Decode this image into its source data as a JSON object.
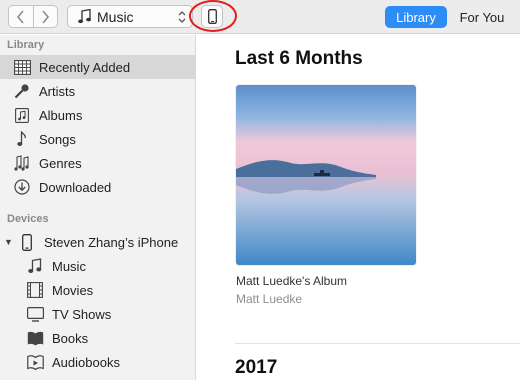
{
  "toolbar": {
    "media_kind": "Music",
    "tabs": [
      {
        "label": "Library",
        "active": true
      },
      {
        "label": "For You",
        "active": false
      }
    ],
    "accent_color": "#2d8cf5",
    "highlight_color": "#e02020"
  },
  "sidebar": {
    "library_title": "Library",
    "library_items": [
      {
        "label": "Recently Added",
        "icon": "grid-icon",
        "selected": true
      },
      {
        "label": "Artists",
        "icon": "microphone-icon"
      },
      {
        "label": "Albums",
        "icon": "album-icon"
      },
      {
        "label": "Songs",
        "icon": "music-note-icon"
      },
      {
        "label": "Genres",
        "icon": "genres-icon"
      },
      {
        "label": "Downloaded",
        "icon": "download-icon"
      }
    ],
    "devices_title": "Devices",
    "device": {
      "label": "Steven Zhang’s iPhone",
      "icon": "iphone-icon"
    },
    "device_items": [
      {
        "label": "Music",
        "icon": "music-note-icon"
      },
      {
        "label": "Movies",
        "icon": "film-icon"
      },
      {
        "label": "TV Shows",
        "icon": "tv-icon"
      },
      {
        "label": "Books",
        "icon": "book-icon"
      },
      {
        "label": "Audiobooks",
        "icon": "audiobook-icon"
      }
    ]
  },
  "main": {
    "section1_title": "Last 6 Months",
    "album": {
      "title": "Matt Luedke's Album",
      "artist": "Matt Luedke"
    },
    "section2_title": "2017"
  }
}
